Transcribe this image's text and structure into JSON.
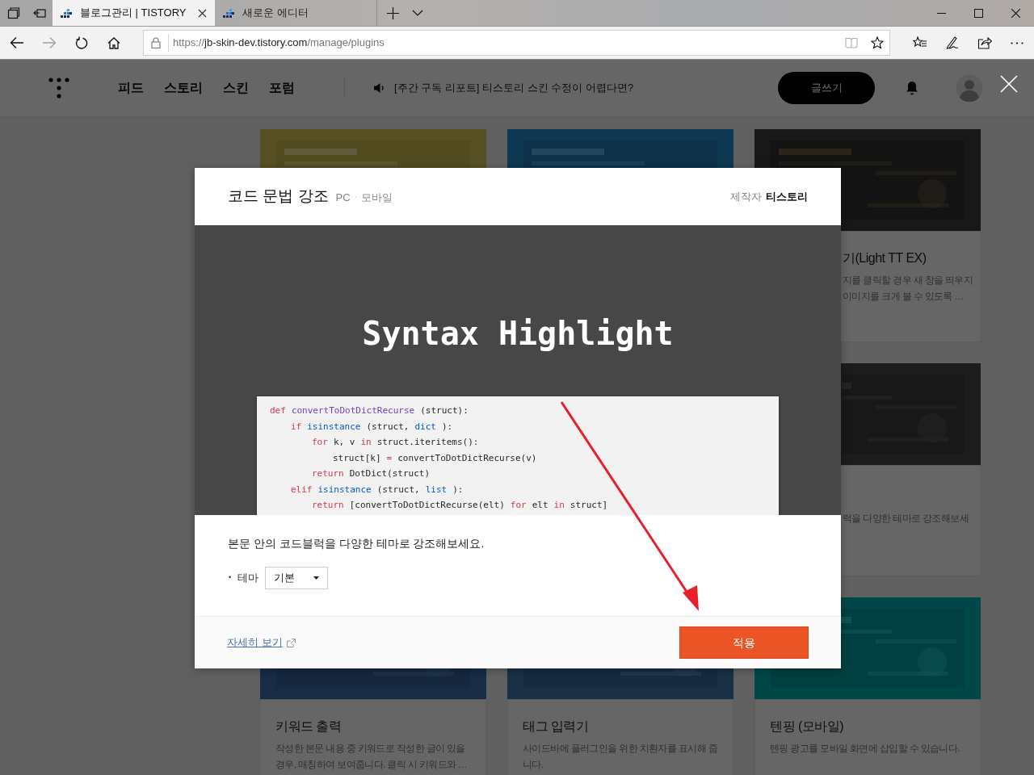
{
  "browser": {
    "tabs": [
      {
        "title": "블로그관리 | TISTORY",
        "selected": true
      },
      {
        "title": "새로운 에디터",
        "selected": false
      }
    ],
    "nav_buttons": [
      {
        "kind": "back",
        "disabled": false
      },
      {
        "kind": "forward",
        "disabled": true
      },
      {
        "kind": "refresh",
        "disabled": false
      },
      {
        "kind": "home",
        "disabled": false
      }
    ],
    "url": {
      "scheme": "https://",
      "host": "jb-skin-dev.tistory.com",
      "path": "/manage/plugins"
    }
  },
  "header": {
    "menu": [
      "피드",
      "스토리",
      "스킨",
      "포럼"
    ],
    "notice": "[주간 구독 리포트] 티스토리 스킨 수정이 어렵다면?",
    "write_button": "글쓰기"
  },
  "plugin_cards": [
    {
      "thumbnail": {
        "kind": "picture"
      }
    },
    {
      "thumbnail": {
        "kind": "picture"
      }
    },
    {
      "thumbnail": {
        "kind": "picture"
      },
      "title": "기(Light TT EX)",
      "description": [
        "지를 클릭할 경우 새 창을 띄우지",
        "이미지를 크게 볼 수 있도록 …"
      ]
    },
    {
      "thumbnail": {
        "kind": "picture"
      },
      "description": [
        "럭을 다양한 테마로 강조해보세"
      ]
    },
    {
      "thumbnail": {
        "kind": "picture"
      },
      "title": "키워드 출력",
      "description": [
        "작성한 본문 내용 중 키워드로 작성한 글이 있을",
        "경우, 매칭하여 보여줍니다. 클릭 시 키워드와 …"
      ]
    },
    {
      "thumbnail": {
        "kind": "picture"
      },
      "title": "태그 입력기",
      "description": [
        "사이드바에 플러그인을 위한 치환자를 표시해 줍",
        "니다."
      ]
    },
    {
      "thumbnail": {
        "kind": "picture"
      },
      "title": "텐핑 (모바일)",
      "description": [
        "텐핑 광고를 모바일 화면에 삽입할 수 있습니다."
      ]
    }
  ],
  "modal": {
    "title": "코드 문법 강조",
    "platforms": [
      "PC",
      "모바일"
    ],
    "platform_separator": "·",
    "maker_label": "제작자",
    "maker": "티스토리",
    "preview_title": "Syntax Highlight",
    "code": [
      {
        "tokens": [
          {
            "kind": "keyword",
            "text": "def"
          },
          {
            "kind": "function",
            "text": "convertToDotDictRecurse"
          },
          {
            "kind": "plain",
            "text": "(struct):"
          }
        ],
        "children": [
          {
            "tokens": [
              {
                "kind": "keyword",
                "text": "if"
              },
              {
                "kind": "builtin",
                "text": "isinstance"
              },
              {
                "kind": "plain",
                "text": "(struct,"
              },
              {
                "kind": "builtin",
                "text": "dict"
              },
              {
                "kind": "plain",
                "text": "):"
              }
            ],
            "children": [
              {
                "tokens": [
                  {
                    "kind": "keyword",
                    "text": "for"
                  },
                  {
                    "kind": "plain",
                    "text": "k, v"
                  },
                  {
                    "kind": "keyword",
                    "text": "in"
                  },
                  {
                    "kind": "plain",
                    "text": "struct.iteritems():"
                  }
                ],
                "children": [
                  {
                    "tokens": [
                      {
                        "kind": "plain",
                        "text": "struct[k]"
                      },
                      {
                        "kind": "keyword",
                        "text": "="
                      },
                      {
                        "kind": "plain",
                        "text": "convertToDotDictRecurse(v)"
                      }
                    ]
                  }
                ]
              },
              {
                "tokens": [
                  {
                    "kind": "keyword",
                    "text": "return"
                  },
                  {
                    "kind": "plain",
                    "text": "DotDict(struct)"
                  }
                ]
              }
            ]
          },
          {
            "tokens": [
              {
                "kind": "keyword",
                "text": "elif"
              },
              {
                "kind": "builtin",
                "text": "isinstance"
              },
              {
                "kind": "plain",
                "text": "(struct,"
              },
              {
                "kind": "builtin",
                "text": "list"
              },
              {
                "kind": "plain",
                "text": "):"
              }
            ],
            "children": [
              {
                "tokens": [
                  {
                    "kind": "keyword",
                    "text": "return"
                  },
                  {
                    "kind": "plain",
                    "text": "[convertToDotDictRecurse(elt)"
                  },
                  {
                    "kind": "keyword",
                    "text": "for"
                  },
                  {
                    "kind": "plain",
                    "text": "elt"
                  },
                  {
                    "kind": "keyword",
                    "text": "in"
                  },
                  {
                    "kind": "plain",
                    "text": "struct]"
                  }
                ]
              }
            ]
          }
        ]
      }
    ],
    "description": "본문 안의 코드블럭을 다양한 테마로 강조해보세요.",
    "bullet": "•",
    "theme_label": "테마",
    "theme_value": "기본",
    "details_link": "자세히 보기",
    "apply_button": "적용"
  }
}
